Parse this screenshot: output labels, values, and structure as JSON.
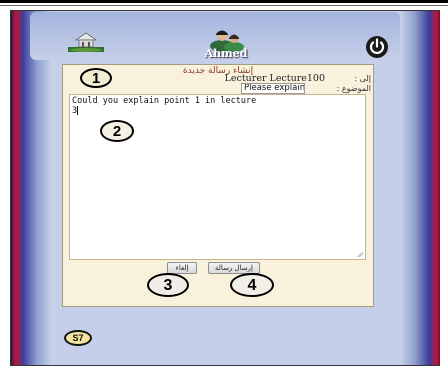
{
  "header": {
    "username": "Ahmed",
    "logo_icon": "university-logo-icon",
    "avatar_icon": "user-avatar-icon",
    "power_icon": "power-icon"
  },
  "compose": {
    "title": "إنشاء رسالة جديدة",
    "to_label": "إلى :",
    "to_value": "Lecturer Lecture100",
    "subject_label": "الموضوع :",
    "subject_value": "Please explain",
    "body": "Could you explain point 1 in lecture\n3",
    "send_button": "إرسال رسالة",
    "cancel_button": "إلغاء"
  },
  "callouts": {
    "one": "1",
    "two": "2",
    "three": "3",
    "four": "4"
  },
  "footer": {
    "badge": "S7"
  },
  "colors": {
    "panel_bg": "#f8f2dd",
    "frame_accent": "#c8102e",
    "frame_dark": "#1c1a6e"
  }
}
